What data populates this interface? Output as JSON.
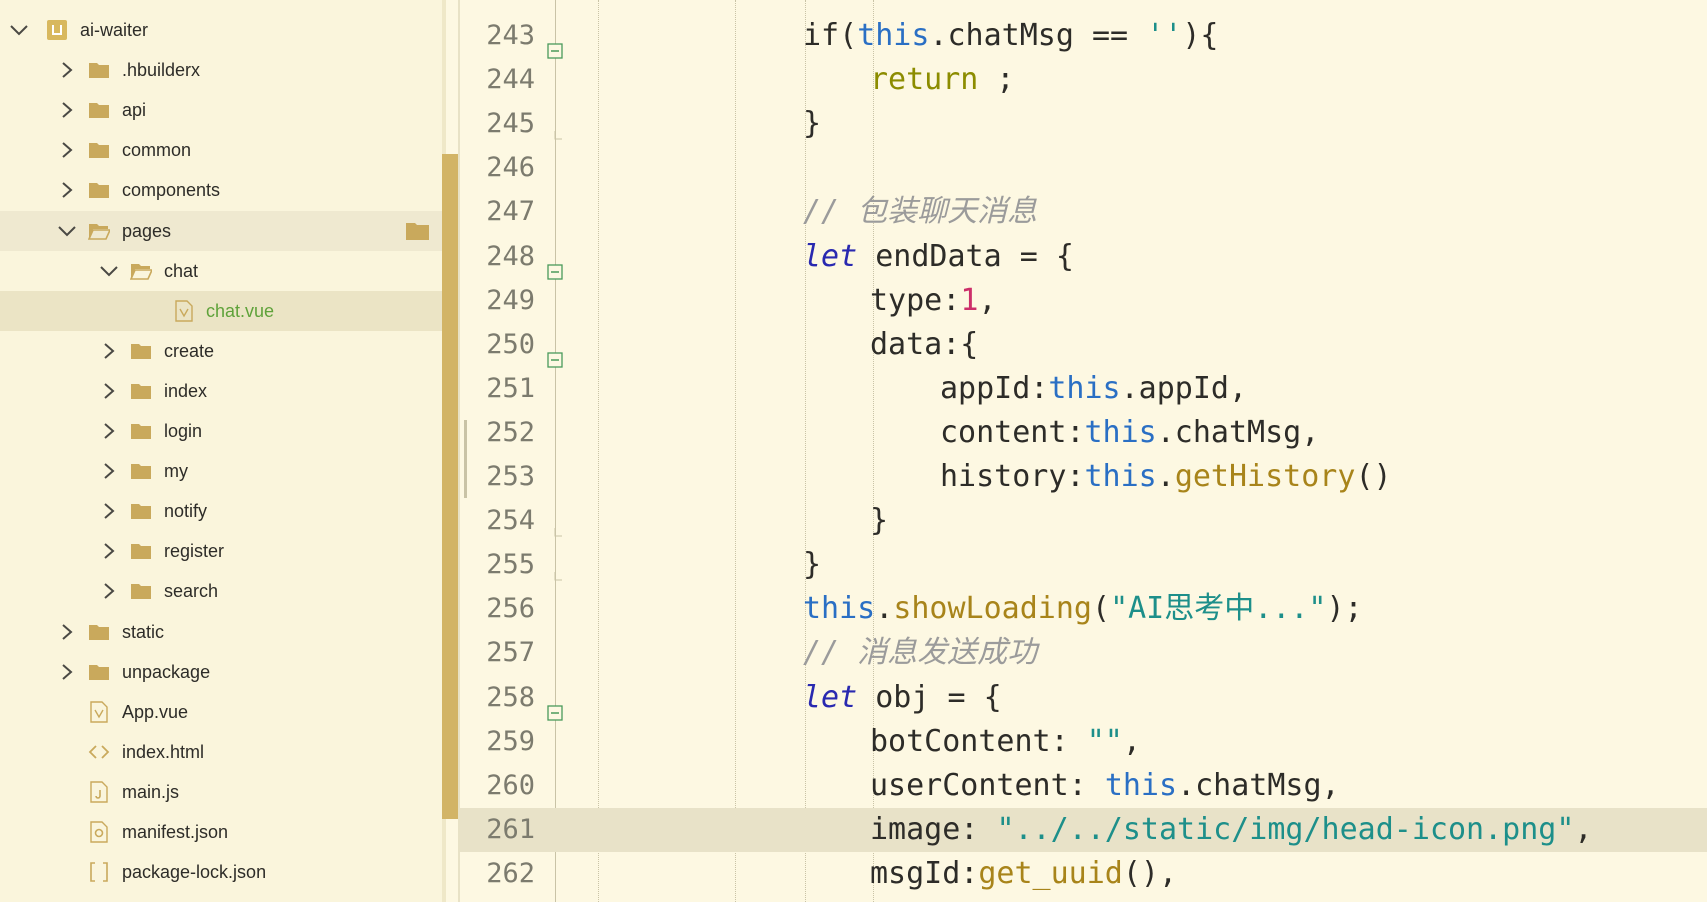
{
  "sidebar": {
    "items": [
      {
        "label": "ai-waiter",
        "type": "project",
        "expanded": true
      },
      {
        "label": ".hbuilderx",
        "type": "folder",
        "expanded": false
      },
      {
        "label": "api",
        "type": "folder",
        "expanded": false
      },
      {
        "label": "common",
        "type": "folder",
        "expanded": false
      },
      {
        "label": "components",
        "type": "folder",
        "expanded": false
      },
      {
        "label": "pages",
        "type": "folder",
        "expanded": true
      },
      {
        "label": "chat",
        "type": "folder",
        "expanded": true
      },
      {
        "label": "chat.vue",
        "type": "vue-file",
        "selected": true
      },
      {
        "label": "create",
        "type": "folder",
        "expanded": false
      },
      {
        "label": "index",
        "type": "folder",
        "expanded": false
      },
      {
        "label": "login",
        "type": "folder",
        "expanded": false
      },
      {
        "label": "my",
        "type": "folder",
        "expanded": false
      },
      {
        "label": "notify",
        "type": "folder",
        "expanded": false
      },
      {
        "label": "register",
        "type": "folder",
        "expanded": false
      },
      {
        "label": "search",
        "type": "folder",
        "expanded": false
      },
      {
        "label": "static",
        "type": "folder",
        "expanded": false
      },
      {
        "label": "unpackage",
        "type": "folder",
        "expanded": false
      },
      {
        "label": "App.vue",
        "type": "vue-file"
      },
      {
        "label": "index.html",
        "type": "html-file"
      },
      {
        "label": "main.js",
        "type": "js-file"
      },
      {
        "label": "manifest.json",
        "type": "manifest-file"
      },
      {
        "label": "package-lock.json",
        "type": "json-file"
      }
    ]
  },
  "editor": {
    "current_line": "261",
    "lines": [
      {
        "num": "243",
        "t": [
          "if(",
          "this",
          ".chatMsg == ",
          "''",
          "){"
        ]
      },
      {
        "num": "244",
        "t": [
          "return",
          " ;"
        ]
      },
      {
        "num": "245",
        "t": [
          "}"
        ]
      },
      {
        "num": "246",
        "t": [
          ""
        ]
      },
      {
        "num": "247",
        "t": [
          "// 包装聊天消息"
        ]
      },
      {
        "num": "248",
        "t": [
          "let",
          " endData = {"
        ]
      },
      {
        "num": "249",
        "t": [
          "type:",
          "1",
          ","
        ]
      },
      {
        "num": "250",
        "t": [
          "data:{"
        ]
      },
      {
        "num": "251",
        "t": [
          "appId:",
          "this",
          ".appId,"
        ]
      },
      {
        "num": "252",
        "t": [
          "content:",
          "this",
          ".chatMsg,"
        ]
      },
      {
        "num": "253",
        "t": [
          "history:",
          "this",
          ".",
          "getHistory",
          "()"
        ]
      },
      {
        "num": "254",
        "t": [
          "}"
        ]
      },
      {
        "num": "255",
        "t": [
          "}"
        ]
      },
      {
        "num": "256",
        "t": [
          "this",
          ".",
          "showLoading",
          "(",
          "\"AI思考中...\"",
          ");"
        ]
      },
      {
        "num": "257",
        "t": [
          "// 消息发送成功"
        ]
      },
      {
        "num": "258",
        "t": [
          "let",
          " obj = {"
        ]
      },
      {
        "num": "259",
        "t": [
          "botContent: ",
          "\"\"",
          ","
        ]
      },
      {
        "num": "260",
        "t": [
          "userContent: ",
          "this",
          ".chatMsg,"
        ]
      },
      {
        "num": "261",
        "t": [
          "image: ",
          "\"../../static/img/head-icon.png\"",
          ","
        ]
      },
      {
        "num": "262",
        "t": [
          "msgId:",
          "get_uuid",
          "(),"
        ]
      }
    ]
  },
  "colors": {
    "background": "#fdf8e2",
    "selected_row": "#ebe4c5",
    "folder": "#c9a95c",
    "active_file_text": "#5fa23a",
    "keyword": "#2a6fc4",
    "string": "#1d8f8a",
    "number": "#cc2f6a",
    "function": "#a8841a",
    "comment": "#9b9b9b",
    "scroll_thumb": "#d2b466"
  }
}
